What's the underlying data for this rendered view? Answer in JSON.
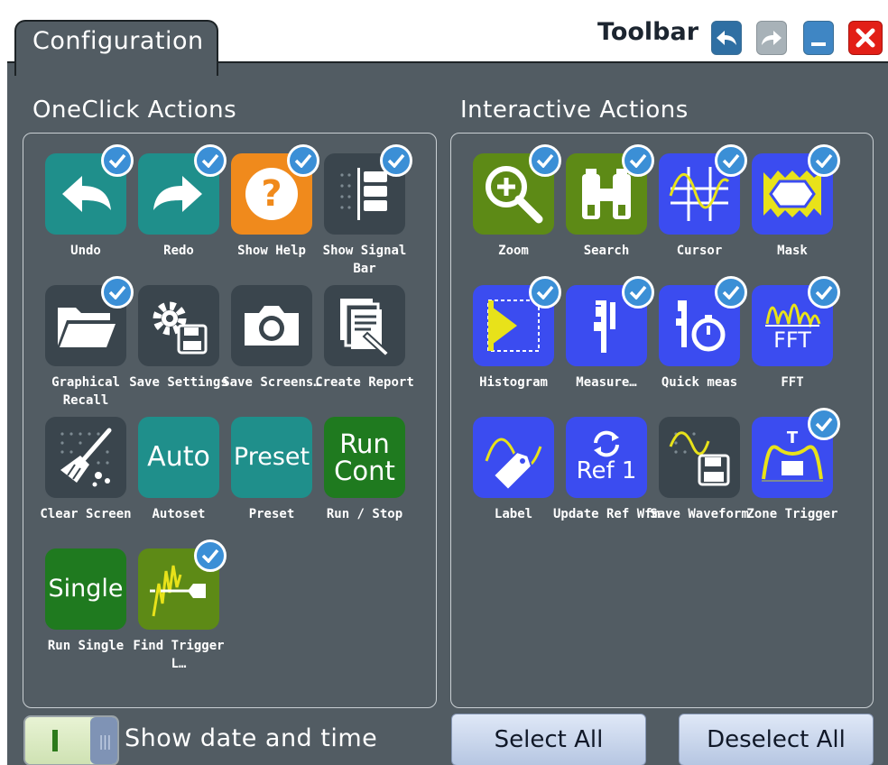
{
  "window": {
    "tab_label": "Configuration",
    "toolbar_title": "Toolbar",
    "buttons": {
      "undo": "undo-icon",
      "redo": "redo-icon",
      "minimize": "minimize-icon",
      "close": "close-icon"
    }
  },
  "oneclick": {
    "title": "OneClick Actions",
    "items": [
      {
        "label": "Undo",
        "icon": "undo-icon",
        "checked": true
      },
      {
        "label": "Redo",
        "icon": "redo-icon",
        "checked": true
      },
      {
        "label": "Show Help",
        "icon": "help-icon",
        "checked": true
      },
      {
        "label": "Show Signal Bar",
        "icon": "signal-bar-icon",
        "checked": true
      },
      {
        "label": "Graphical Recall",
        "icon": "folder-icon",
        "checked": true
      },
      {
        "label": "Save Settings",
        "icon": "save-settings-icon",
        "checked": false
      },
      {
        "label": "Save Screens…",
        "icon": "camera-icon",
        "checked": false
      },
      {
        "label": "Create Report",
        "icon": "report-icon",
        "checked": false
      },
      {
        "label": "Clear Screen",
        "icon": "clear-screen-icon",
        "checked": false
      },
      {
        "label": "Autoset",
        "icon_text": "Auto",
        "checked": false
      },
      {
        "label": "Preset",
        "icon_text": "Preset",
        "checked": false
      },
      {
        "label": "Run / Stop",
        "icon_text": "Run Cont",
        "checked": false
      },
      {
        "label": "Run Single",
        "icon_text": "Single",
        "checked": false
      },
      {
        "label": "Find Trigger L…",
        "icon": "find-trigger-level-icon",
        "checked": true
      }
    ]
  },
  "interactive": {
    "title": "Interactive Actions",
    "items": [
      {
        "label": "Zoom",
        "icon": "zoom-icon",
        "checked": true
      },
      {
        "label": "Search",
        "icon": "binoculars-icon",
        "checked": true
      },
      {
        "label": "Cursor",
        "icon": "cursor-icon",
        "checked": true
      },
      {
        "label": "Mask",
        "icon": "mask-icon",
        "checked": true
      },
      {
        "label": "Histogram",
        "icon": "histogram-icon",
        "checked": true
      },
      {
        "label": "Measure…",
        "icon": "measure-icon",
        "checked": true
      },
      {
        "label": "Quick meas",
        "icon": "quick-meas-icon",
        "checked": true
      },
      {
        "label": "FFT",
        "icon": "fft-icon",
        "icon_text": "FFT",
        "checked": true
      },
      {
        "label": "Label",
        "icon": "label-icon",
        "checked": false
      },
      {
        "label": "Update Ref Wfm",
        "icon_text": "Ref 1",
        "icon": "refresh-icon",
        "checked": false
      },
      {
        "label": "Save Waveform",
        "icon": "save-waveform-icon",
        "checked": false
      },
      {
        "label": "Zone Trigger",
        "icon": "zone-trigger-icon",
        "icon_text": "T",
        "checked": true
      }
    ]
  },
  "footer": {
    "toggle_label": "Show date and time",
    "toggle_state": "on",
    "select_all": "Select All",
    "deselect_all": "Deselect All"
  },
  "colors": {
    "panel": "#525c63",
    "teal": "#1f8f8b",
    "orange": "#f08a1c",
    "slate": "#3a454d",
    "green": "#1f7a1f",
    "olive": "#5d8a16",
    "blue": "#3b4cf0",
    "check": "#3b8fd6"
  }
}
